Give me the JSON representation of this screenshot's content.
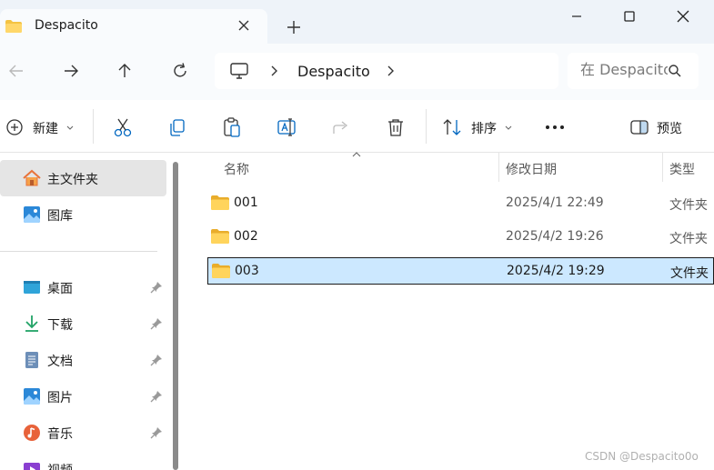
{
  "colors": {
    "accent": "#0067c0",
    "selected_row": "#cce8ff",
    "folder": "#f4c343"
  },
  "tab": {
    "title": "Despacito",
    "icon": "folder-icon"
  },
  "address": {
    "crumb": "Despacito",
    "icon": "computer-icon"
  },
  "search": {
    "placeholder": "在 Despacito 中搜索"
  },
  "toolbar": {
    "new_label": "新建",
    "sort_label": "排序",
    "preview_label": "预览",
    "icons": [
      "cut-icon",
      "copy-icon",
      "paste-icon",
      "rename-icon",
      "share-icon",
      "delete-icon",
      "more-icon"
    ]
  },
  "sidebar": {
    "top": [
      {
        "label": "主文件夹",
        "icon": "home-icon",
        "selected": true
      },
      {
        "label": "图库",
        "icon": "gallery-icon"
      }
    ],
    "pinned": [
      {
        "label": "桌面",
        "icon": "desktop-icon"
      },
      {
        "label": "下载",
        "icon": "download-icon"
      },
      {
        "label": "文档",
        "icon": "document-icon"
      },
      {
        "label": "图片",
        "icon": "pictures-icon"
      },
      {
        "label": "音乐",
        "icon": "music-icon"
      },
      {
        "label": "视频",
        "icon": "video-icon"
      }
    ]
  },
  "columns": {
    "name": "名称",
    "date": "修改日期",
    "type": "类型"
  },
  "files": [
    {
      "name": "001",
      "date": "2025/4/1 22:49",
      "type": "文件夹"
    },
    {
      "name": "002",
      "date": "2025/4/2 19:26",
      "type": "文件夹"
    },
    {
      "name": "003",
      "date": "2025/4/2 19:29",
      "type": "文件夹",
      "selected": true
    }
  ],
  "watermark": "CSDN @Despacito0o"
}
